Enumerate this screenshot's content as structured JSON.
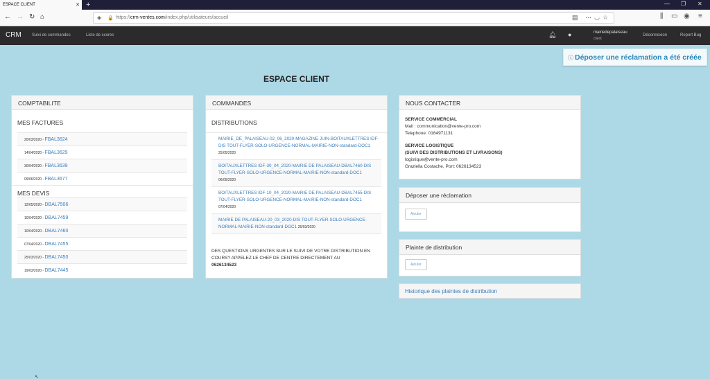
{
  "browser": {
    "tab_title": "ESPACE CLIENT",
    "url_prefix": "https://",
    "url_domain": "crm-ventes.com",
    "url_path": "/index.php/utilisateurs/accueil"
  },
  "app": {
    "brand": "CRM",
    "nav": [
      "Suivi de commandes",
      "Liste de scores"
    ],
    "user_name": "mairiedepalaiseau",
    "user_role": "client",
    "logout": "Déconnexion",
    "report_bug": "Report Bug"
  },
  "toast": "Déposer une réclamation a été créée",
  "page_title": "ESPACE CLIENT",
  "comptabilite": {
    "header": "COMPTABILITE",
    "factures_title": "MES FACTURES",
    "factures": [
      {
        "date": "20/03/2020",
        "ref": "FBAL3624"
      },
      {
        "date": "14/04/2020",
        "ref": "FBAL3629"
      },
      {
        "date": "30/04/2020",
        "ref": "FBAL3639"
      },
      {
        "date": "09/06/2020",
        "ref": "FBAL3677"
      }
    ],
    "devis_title": "MES DEVIS",
    "devis": [
      {
        "date": "12/05/2020",
        "ref": "DBAL7506"
      },
      {
        "date": "10/04/2020",
        "ref": "DBAL7459"
      },
      {
        "date": "10/04/2020",
        "ref": "DBAL7460"
      },
      {
        "date": "07/04/2020",
        "ref": "DBAL7455"
      },
      {
        "date": "25/03/2020",
        "ref": "DBAL7450"
      },
      {
        "date": "19/03/2020",
        "ref": "DBAL7445"
      }
    ]
  },
  "commandes": {
    "header": "COMMANDES",
    "dist_title": "DISTRIBUTIONS",
    "items": [
      {
        "text": "MAIRIE_DE_PALAISEAU-02_06_2020-MAGAZINE JUIN-BOITAUXLETTRES IDF-DIS TOUT-FLYER-SOLO-URGENCE-NORMAL-MAIRIE-NON-standard-DOC1",
        "date": "25/05/2020"
      },
      {
        "text": "BOITAUXLETTRES IDF-30_04_2020-MAIRIE DE PALAISEAU-DBAL7460-DIS TOUT-FLYER-SOLO-URGENCE-NORMAL-MAIRIE-NON-standard-DOC1",
        "date": "06/05/2020"
      },
      {
        "text": "BOITAUXLETTRES IDF-10_04_2020-MAIRIE DE PALAISEAU-DBAL7455-DIS TOUT-FLYER-SOLO-URGENCE-NORMAL-MAIRIE-NON-standard-DOC1",
        "date": "07/04/2020"
      },
      {
        "text": "MAIRIE DE PALAISEAU-20_03_2020-DIS TOUT-FLYER-SOLO-URGENCE-NORMAL-MAIRIE-NON-standard-DOC1",
        "date": "26/03/2020"
      }
    ],
    "urgent_text": "DES QUESTIONS URGENTES SUR LE SUIVI DE VOTRE DISTRIBUTION EN COURS? APPELEZ LE CHEF DE CENTRE DIRECTEMENT AU",
    "urgent_phone": "0626134523"
  },
  "contact": {
    "header": "NOUS CONTACTER",
    "commercial_title": "SERVICE COMMERCIAL",
    "commercial_mail": "Mail : communication@vente-pro.com",
    "commercial_tel": "Telephone: 0164971131",
    "logistique_title": "SERVICE LOGISTIQUE",
    "logistique_sub": "(SUIVI DES DISTRIBUTIONS ET LIVRAISONS)",
    "logistique_mail": "logistique@vente-pro.com",
    "logistique_person": "Graziella Costache, Port: 0626134523"
  },
  "reclamation": {
    "header": "Déposer une réclamation",
    "button": "Ajouter"
  },
  "plainte": {
    "header": "Plainte de distribution",
    "button": "Ajouter"
  },
  "historique": "Historique des plaintes de distribution"
}
